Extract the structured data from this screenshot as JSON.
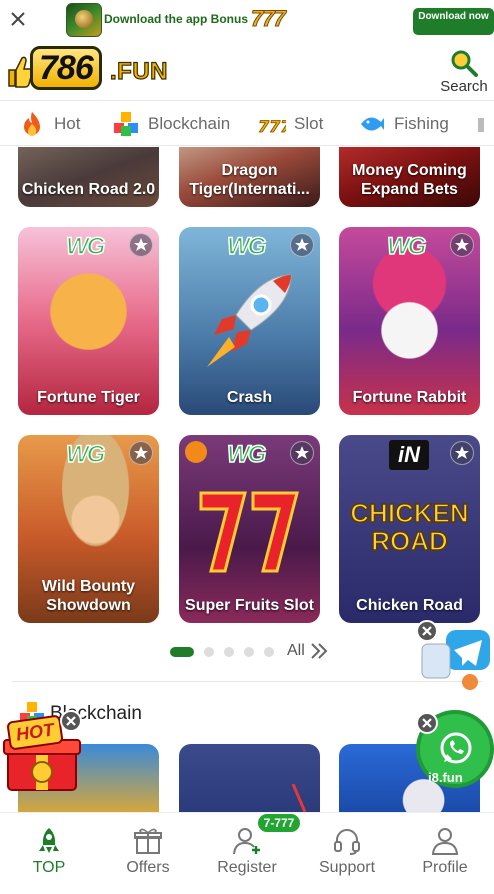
{
  "banner": {
    "download_text": "Download the app Bonus",
    "bonus_amount": "777",
    "download_button": "Download now",
    "app_icon_label": "786.FUN"
  },
  "header": {
    "logo_number": "786",
    "logo_suffix": ".FUN",
    "search_label": "Search"
  },
  "tabs": [
    {
      "label": "Hot",
      "icon": "fire-icon"
    },
    {
      "label": "Blockchain",
      "icon": "blocks-icon"
    },
    {
      "label": "Slot",
      "icon": "slot-777-icon"
    },
    {
      "label": "Fishing",
      "icon": "fish-icon"
    }
  ],
  "games_row0": [
    {
      "name": "Chicken Road 2.0"
    },
    {
      "name": "Dragon Tiger(Internati..."
    },
    {
      "name": "Money Coming Expand Bets"
    }
  ],
  "games_row1": [
    {
      "name": "Fortune Tiger",
      "provider": "WG"
    },
    {
      "name": "Crash",
      "provider": "WG"
    },
    {
      "name": "Fortune Rabbit",
      "provider": "WG"
    }
  ],
  "games_row2": [
    {
      "name": "Wild Bounty Showdown",
      "provider": "WG"
    },
    {
      "name": "Super Fruits Slot",
      "provider": "WG"
    },
    {
      "name": "Chicken Road",
      "provider": "iN"
    }
  ],
  "pager": {
    "all_label": "All",
    "pages": 5,
    "active": 1
  },
  "section": {
    "title": "Blockchain"
  },
  "floating": {
    "hot_label": "HOT",
    "whatsapp_caption": "i8.fun"
  },
  "nav": {
    "top": "TOP",
    "offers": "Offers",
    "register": "Register",
    "register_badge": "7-777",
    "support": "Support",
    "profile": "Profile"
  },
  "colors": {
    "brand_green": "#1f7d2a",
    "gold": "#f2b200"
  }
}
